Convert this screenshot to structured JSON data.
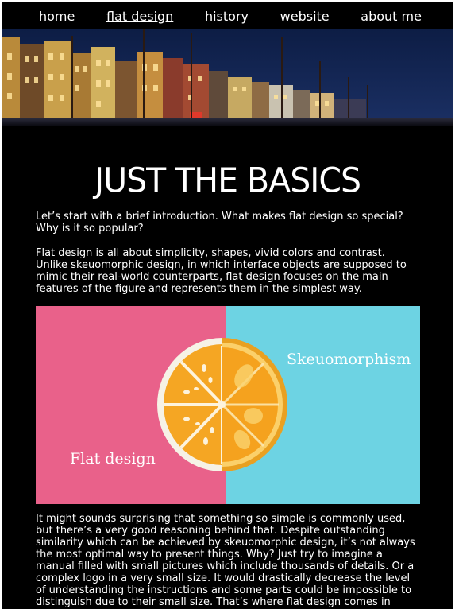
{
  "nav": {
    "items": [
      {
        "label": "home",
        "active": false
      },
      {
        "label": "flat design",
        "active": true
      },
      {
        "label": "history",
        "active": false
      },
      {
        "label": "website",
        "active": false
      },
      {
        "label": "about me",
        "active": false
      }
    ]
  },
  "main": {
    "heading": "JUST THE BASICS",
    "intro": "Let’s start with a brief introduction. What makes flat design so special? Why is it so popular?",
    "paragraph1": "Flat design is all about simplicity, shapes, vivid colors and contrast. Unlike skeuomorphic design, in which interface objects are supposed to mimic their real-world counterparts, flat design focuses on the main features of the figure and represents them in the simplest way.",
    "illustration": {
      "left_label": "Flat design",
      "right_label": "Skeuomorphism",
      "left_color": "#e9618a",
      "right_color": "#6dd3e3"
    },
    "paragraph2": "It might sounds surprising that something so simple is commonly used, but there’s a very good reasoning behind that. Despite outstanding similarity which can be achieved by skeuomorphic design, it’s not always the most optimal way to present things. Why? Just try to imagine a manual filled with small pictures which include thousands of details. Or a complex logo in a very small size. It would drastically decrease the level of understanding the instructions and some parts could be impossible to distinguish due to their small size. That’s where flat design comes in"
  }
}
